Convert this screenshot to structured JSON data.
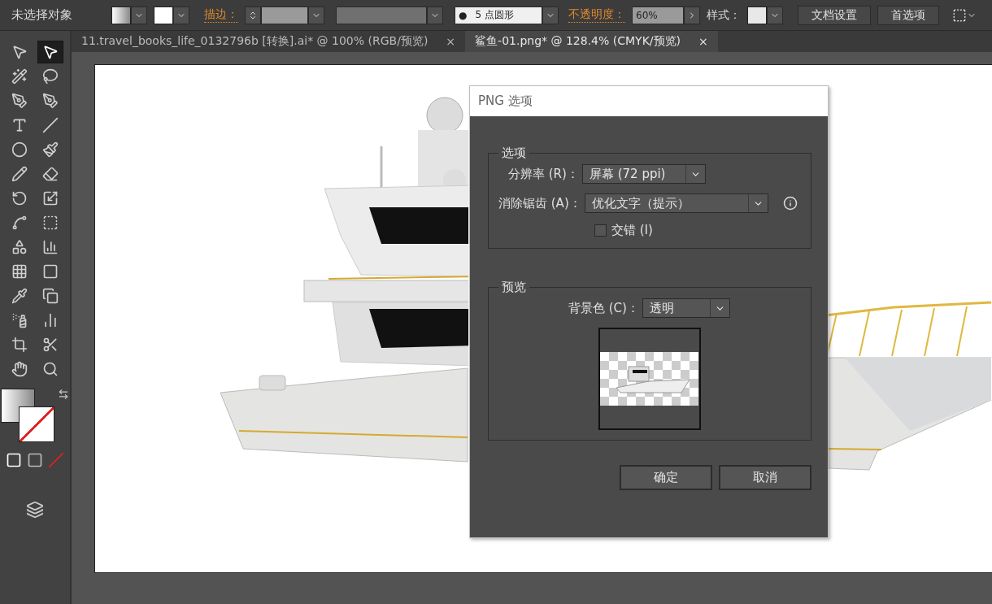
{
  "control_bar": {
    "selection_status": "未选择对象",
    "stroke_label": "描边：",
    "brush": {
      "dot": "●",
      "value": "5 点圆形"
    },
    "opacity_label": "不透明度：",
    "opacity_value": "60%",
    "style_label": "样式：",
    "buttons": [
      "文档设置",
      "首选项"
    ]
  },
  "tabs": [
    {
      "label": "11.travel_books_life_0132796b  [转换].ai* @ 100% (RGB/预览)",
      "close": "×",
      "selected": false
    },
    {
      "label": "鲨鱼-01.png* @ 128.4% (CMYK/预览)",
      "close": "×",
      "selected": true
    }
  ],
  "toolbox": {
    "tools": [
      {
        "selected": false
      },
      {
        "selected": true
      },
      {
        "selected": false
      },
      {
        "selected": false
      },
      {
        "selected": false
      },
      {
        "selected": false
      },
      {
        "selected": false
      },
      {
        "selected": false
      },
      {
        "selected": false
      },
      {
        "selected": false
      },
      {
        "selected": false
      },
      {
        "selected": false
      },
      {
        "selected": false
      },
      {
        "selected": false
      },
      {
        "selected": false
      },
      {
        "selected": false
      },
      {
        "selected": false
      },
      {
        "selected": false
      },
      {
        "selected": false
      },
      {
        "selected": false
      },
      {
        "selected": false
      },
      {
        "selected": false
      },
      {
        "selected": false
      },
      {
        "selected": false
      },
      {
        "selected": false
      },
      {
        "selected": false
      },
      {
        "selected": false
      },
      {
        "selected": false
      }
    ]
  },
  "dialog": {
    "title": "PNG 选项",
    "options_group": {
      "title": "选项",
      "resolution_label": "分辨率 (R)：",
      "resolution_value": "屏幕 (72 ppi)",
      "antialias_label": "消除锯齿 (A)：",
      "antialias_value": "优化文字（提示）",
      "interlace": {
        "label": "交错 (I)",
        "checked": false
      }
    },
    "preview_group": {
      "title": "预览",
      "background_label": "背景色 (C)：",
      "background_value": "透明"
    },
    "buttons": [
      "确定",
      "取消"
    ]
  }
}
